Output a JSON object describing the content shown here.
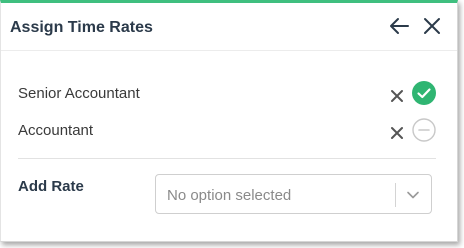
{
  "dialog": {
    "title": "Assign Time Rates",
    "icons": {
      "back": "arrow-left-icon",
      "close": "close-icon"
    }
  },
  "roles": [
    {
      "label": "Senior Accountant",
      "status": "selected",
      "status_icon": "check-circle-icon",
      "remove_icon": "remove-x-icon"
    },
    {
      "label": "Accountant",
      "status": "unselected",
      "status_icon": "minus-circle-icon",
      "remove_icon": "remove-x-icon"
    }
  ],
  "add_rate": {
    "label": "Add Rate",
    "placeholder": "No option selected",
    "dropdown_icon": "chevron-down-icon"
  },
  "colors": {
    "accent": "#3fbf7f",
    "check": "#2fb572",
    "title_text": "#2b3a4a",
    "muted_icon": "#c8c8c8"
  }
}
